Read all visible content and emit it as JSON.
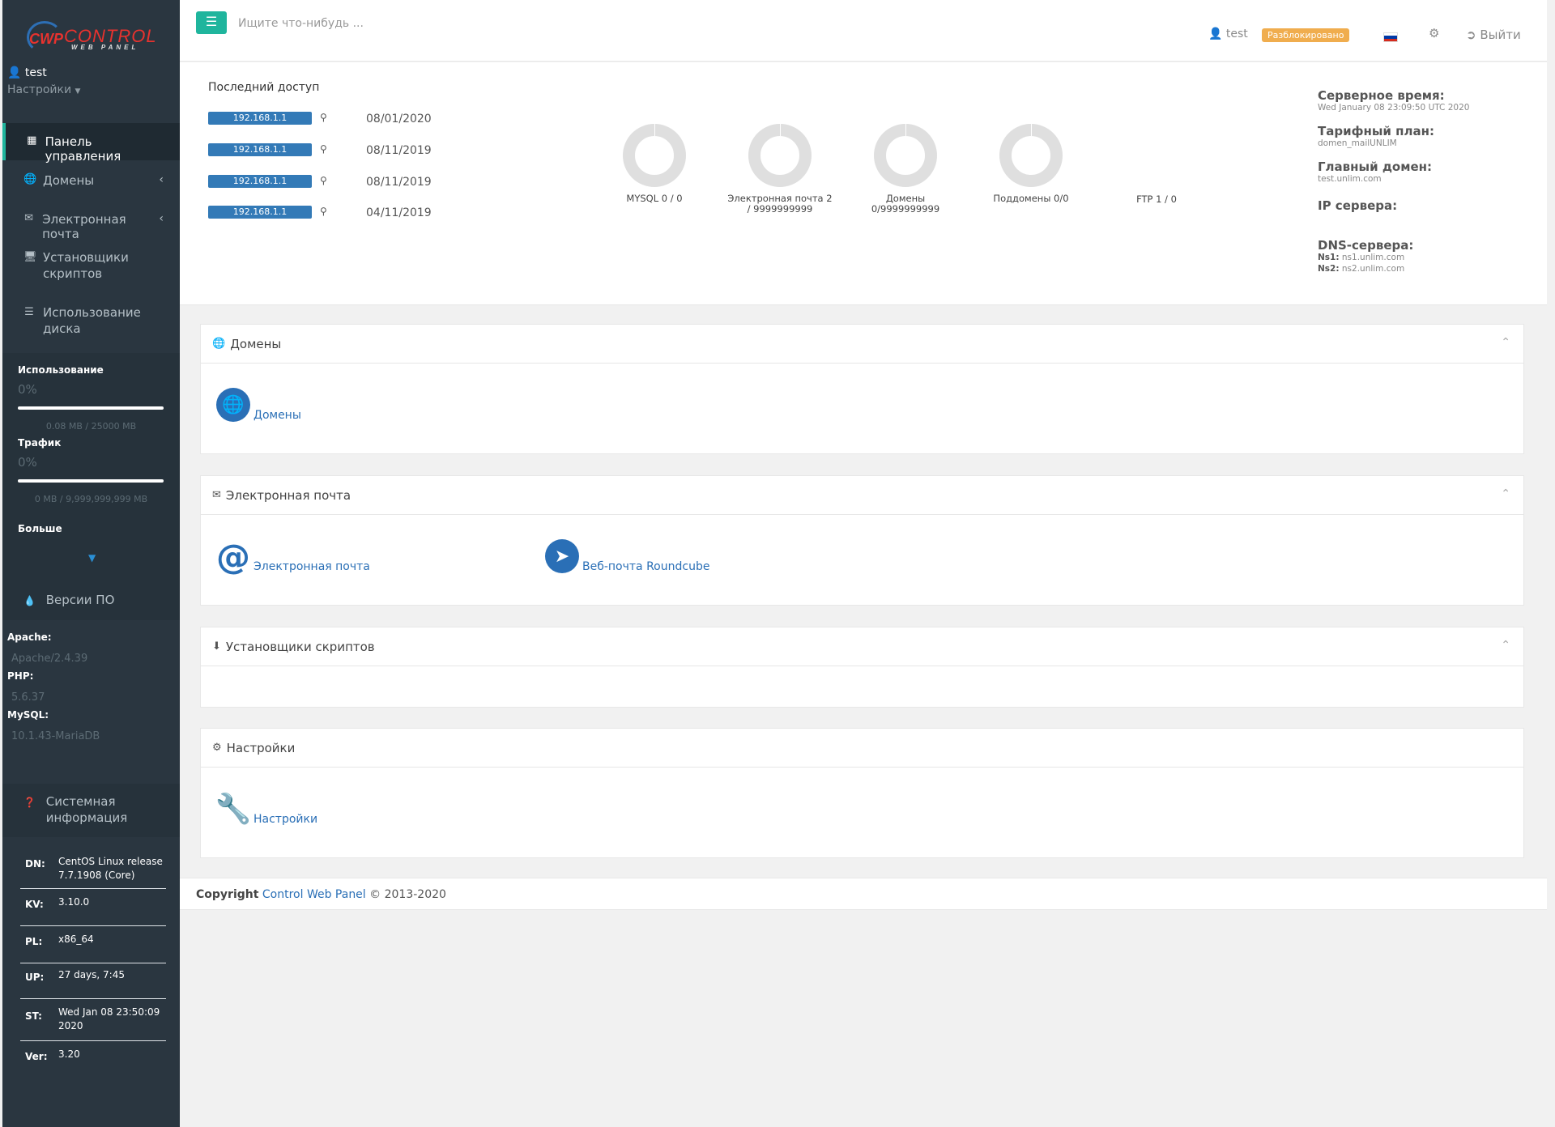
{
  "logo": {
    "cwp": "CWP",
    "control": "CONTROL",
    "webpanel": "WEB PANEL"
  },
  "user": {
    "name": "test",
    "settings": "Настройки"
  },
  "menu": [
    {
      "label": "Панель управления",
      "icon": "dashboard-icon"
    },
    {
      "label": "Домены",
      "icon": "globe-icon"
    },
    {
      "label": "Электронная почта",
      "icon": "envelope-icon"
    },
    {
      "label": "Установщики скриптов",
      "icon": "desktop-icon"
    },
    {
      "label": "Использование диска",
      "icon": "list-icon"
    }
  ],
  "usage": {
    "disk_label": "Использование",
    "disk_pct": "0%",
    "disk_val": "0.08 MB / 25000 MB",
    "traffic_label": "Трафик",
    "traffic_pct": "0%",
    "traffic_val": "0 MB / 9,999,999,999 MB",
    "more": "Больше"
  },
  "versions": {
    "title": "Версии ПО",
    "apache_label": "Apache:",
    "apache": "Apache/2.4.39",
    "php_label": "PHP:",
    "php": "5.6.37",
    "mysql_label": "MySQL:",
    "mysql": "10.1.43-MariaDB"
  },
  "sysinfo": {
    "title": "Системная информация",
    "rows": [
      {
        "k": "DN:",
        "v": "CentOS Linux release 7.7.1908 (Core)"
      },
      {
        "k": "KV:",
        "v": "3.10.0"
      },
      {
        "k": "PL:",
        "v": "x86_64"
      },
      {
        "k": "UP:",
        "v": "27 days, 7:45"
      },
      {
        "k": "ST:",
        "v": "Wed Jan 08 23:50:09 2020"
      },
      {
        "k": "Ver:",
        "v": "3.20"
      }
    ]
  },
  "topbar": {
    "search_placeholder": "Ищите что-нибудь ...",
    "user": "test",
    "status": "Разблокировано",
    "logout": "Выйти",
    "flag_colors": [
      "#ffffff",
      "#0039a6",
      "#d52b1e"
    ]
  },
  "last_access": {
    "title": "Последний доступ",
    "rows": [
      {
        "ip": "192.168.1.1",
        "date": "08/01/2020"
      },
      {
        "ip": "192.168.1.1",
        "date": "08/11/2019"
      },
      {
        "ip": "192.168.1.1",
        "date": "08/11/2019"
      },
      {
        "ip": "192.168.1.1",
        "date": "04/11/2019"
      }
    ]
  },
  "donuts": [
    {
      "label": "MYSQL 0 / 0"
    },
    {
      "label": "Электронная почта 2 / 9999999999"
    },
    {
      "label": "Домены 0/9999999999"
    },
    {
      "label": "Поддомены 0/0"
    }
  ],
  "ftp": "FTP 1 / 0",
  "server": {
    "time_label": "Серверное время:",
    "time": "Wed January 08 23:09:50 UTC 2020",
    "plan_label": "Тарифный план:",
    "plan": "domen_mailUNLIM",
    "domain_label": "Главный домен:",
    "domain": "test.unlim.com",
    "ip_label": "IP сервера:",
    "dns_label": "DNS-сервера:",
    "ns1_label": "Ns1:",
    "ns1": "ns1.unlim.com",
    "ns2_label": "Ns2:",
    "ns2": "ns2.unlim.com"
  },
  "boxes": {
    "domains": {
      "title": "Домены",
      "item": "Домены"
    },
    "email": {
      "title": "Электронная почта",
      "item1": "Электронная почта",
      "item2": "Веб-почта Roundcube"
    },
    "scripts": {
      "title": "Установщики скриптов"
    },
    "settings": {
      "title": "Настройки",
      "item": "Настройки"
    }
  },
  "footer": {
    "copyright": "Copyright",
    "link": "Control Web Panel",
    "years": "© 2013-2020"
  }
}
